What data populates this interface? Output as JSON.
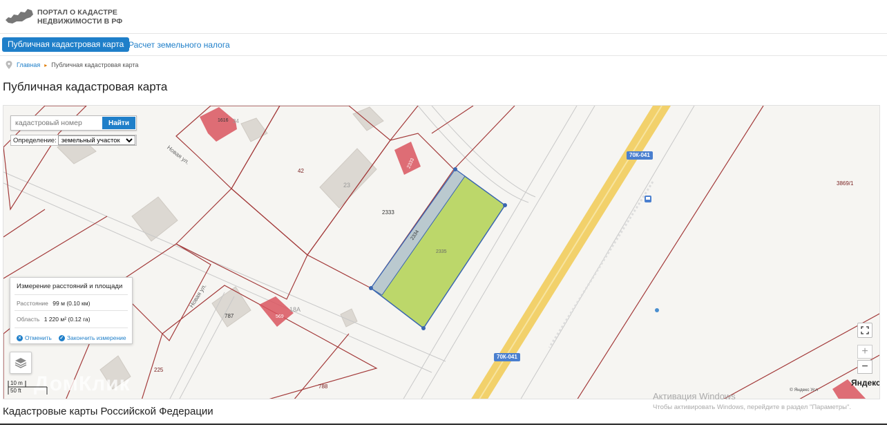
{
  "header": {
    "logo_line1": "ПОРТАЛ О КАДАСТРЕ",
    "logo_line2": "НЕДВИЖИМОСТИ В РФ"
  },
  "nav": {
    "tab_active": "Публичная кадастровая карта",
    "tab_tax": "Расчет земельного налога"
  },
  "breadcrumb": {
    "home": "Главная",
    "current": "Публичная кадастровая карта"
  },
  "page_title": "Публичная кадастровая карта",
  "map": {
    "search": {
      "placeholder": "кадастровый номер",
      "button": "Найти"
    },
    "definition": {
      "label": "Определение:",
      "selected": "земельный участок"
    },
    "measure": {
      "title": "Измерение расстояний и площади",
      "distance_label": "Расстояние",
      "distance_value": "99 м (0.10 км)",
      "area_label": "Область",
      "area_value": "1 220 м² (0.12 га)",
      "cancel": "Отменить",
      "finish": "Закончить измерение"
    },
    "scale": {
      "metric": "10 m",
      "imperial": "50 ft"
    },
    "road_badge_top": "70К-041",
    "road_badge_bottom": "70К-041",
    "labels": {
      "parcel_42": "42",
      "parcel_23": "23",
      "parcel_2333": "2333",
      "parcel_2334": "2334",
      "parcel_2335": "2335",
      "parcel_3869": "3869/1",
      "parcel_787": "787",
      "parcel_18a": "18А",
      "parcel_225": "225",
      "parcel_788": "788",
      "parcel_1616": "1616",
      "parcel_34": "34",
      "building_2333": "2333",
      "building_569": "569"
    },
    "streets": {
      "novaya_1": "Новая ул.",
      "novaya_2": "Новая ул."
    },
    "watermark": "ДомКлик",
    "yandex": "Яндекс",
    "copyright": "© Яндекс  Усл"
  },
  "windows_activation": {
    "title": "Активация Windows",
    "subtitle": "Чтобы активировать Windows, перейдите в раздел \"Параметры\"."
  },
  "section_title": "Кадастровые карты Российской Федерации",
  "colors": {
    "accent": "#1f7fc9",
    "parcel_line": "#a33a3a",
    "parcel_fill": "#a8cc3c",
    "building_red": "#d9555f",
    "road_yellow": "#f2c94c"
  }
}
